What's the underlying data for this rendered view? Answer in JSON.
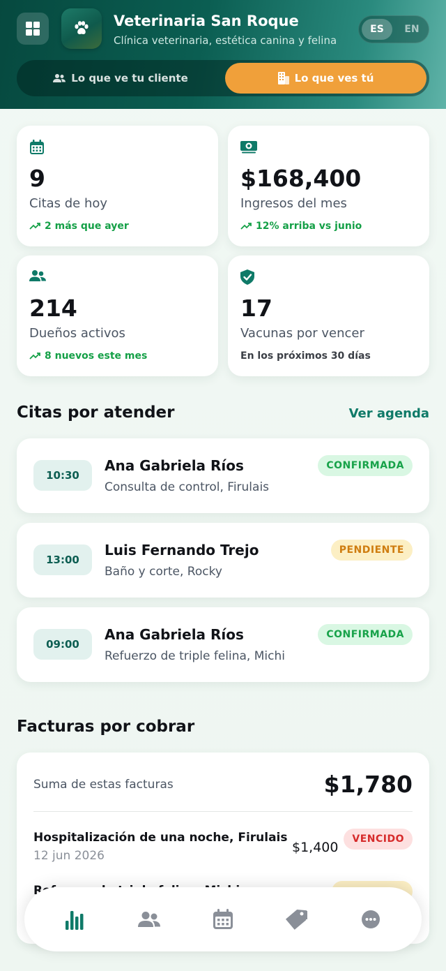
{
  "header": {
    "title": "Veterinaria San Roque",
    "subtitle": "Clínica veterinaria, estética canina y felina",
    "lang": {
      "es": "ES",
      "en": "EN",
      "active": "ES"
    },
    "views": {
      "client": "Lo que ve tu cliente",
      "you": "Lo que ves tú",
      "active": "you"
    }
  },
  "stats": [
    {
      "icon": "calendar-icon",
      "value": "9",
      "label": "Citas de hoy",
      "trend": "2 más que ayer"
    },
    {
      "icon": "money-icon",
      "value": "$168,400",
      "label": "Ingresos del mes",
      "trend": "12% arriba vs junio"
    },
    {
      "icon": "people-icon",
      "value": "214",
      "label": "Dueños activos",
      "trend": "8 nuevos este mes"
    },
    {
      "icon": "shield-check-icon",
      "value": "17",
      "label": "Vacunas por vencer",
      "note": "En los próximos 30 días"
    }
  ],
  "appointments": {
    "title": "Citas por atender",
    "link": "Ver agenda",
    "items": [
      {
        "time": "10:30",
        "name": "Ana Gabriela Ríos",
        "desc": "Consulta de control, Firulais",
        "status": "CONFIRMADA"
      },
      {
        "time": "13:00",
        "name": "Luis Fernando Trejo",
        "desc": "Baño y corte, Rocky",
        "status": "PENDIENTE"
      },
      {
        "time": "09:00",
        "name": "Ana Gabriela Ríos",
        "desc": "Refuerzo de triple felina, Michi",
        "status": "CONFIRMADA"
      }
    ]
  },
  "invoices": {
    "title": "Facturas por cobrar",
    "sum_label": "Suma de estas facturas",
    "sum_value": "$1,780",
    "items": [
      {
        "title": "Hospitalización de una noche, Firulais",
        "date": "12 jun 2026",
        "amount": "$1,400",
        "status": "VENCIDO"
      },
      {
        "title": "Refuerzo de triple felina, Michi",
        "status": ""
      }
    ]
  },
  "colors": {
    "brand": "#0b5e52",
    "accent": "#f0a03a",
    "positive": "#15a047"
  },
  "bottom_nav": [
    {
      "icon": "chart-bars-icon",
      "active": true
    },
    {
      "icon": "people-icon",
      "active": false
    },
    {
      "icon": "calendar-icon",
      "active": false
    },
    {
      "icon": "tag-icon",
      "active": false
    },
    {
      "icon": "more-icon",
      "active": false
    }
  ]
}
